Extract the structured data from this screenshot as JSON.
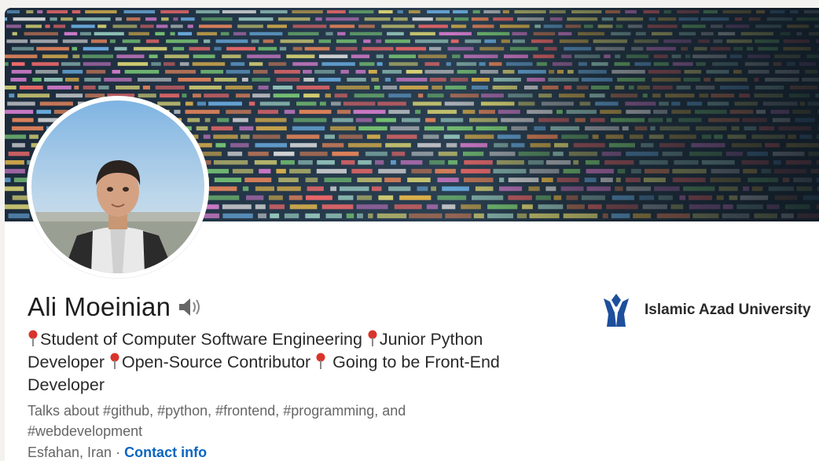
{
  "profile": {
    "name": "Ali Moeinian",
    "headline_parts": [
      "Student of Computer Software Engineering ",
      "Junior Python Developer ",
      "Open-Source Contributor ",
      " Going to be Front-End Developer"
    ],
    "talks_about": "Talks about #github, #python, #frontend, #programming, and #webdevelopment",
    "location": "Esfahan, Iran",
    "separator": " · ",
    "contact_label": "Contact info"
  },
  "education": {
    "name": "Islamic Azad University"
  },
  "icons": {
    "speaker": "speaker-icon",
    "pin": "pushpin-icon",
    "university_logo": "university-logo-icon"
  },
  "colors": {
    "link": "#0a66c2",
    "pin": "#d9342b",
    "logo": "#1e4f9c"
  }
}
